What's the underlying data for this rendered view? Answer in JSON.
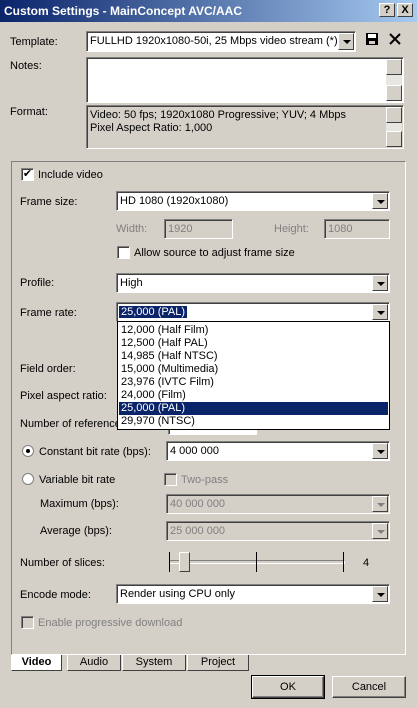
{
  "window": {
    "title": "Custom Settings - MainConcept AVC/AAC",
    "help_btn": "?",
    "close_btn": "X"
  },
  "template": {
    "label": "Template:",
    "value": "FULLHD 1920x1080-50i, 25 Mbps video stream (*)"
  },
  "notes": {
    "label": "Notes:",
    "value": ""
  },
  "format": {
    "label": "Format:",
    "line1": "Video: 50 fps; 1920x1080 Progressive; YUV; 4 Mbps",
    "line2": "Pixel Aspect Ratio: 1,000"
  },
  "video": {
    "include_video": "Include video",
    "frame_size": {
      "label": "Frame size:",
      "value": "HD 1080 (1920x1080)"
    },
    "width": {
      "label": "Width:",
      "value": "1920"
    },
    "height": {
      "label": "Height:",
      "value": "1080"
    },
    "allow_source": "Allow source to adjust frame size",
    "profile": {
      "label": "Profile:",
      "value": "High"
    },
    "frame_rate": {
      "label": "Frame rate:",
      "value": "25,000 (PAL)",
      "options": [
        "12,000 (Half Film)",
        "12,500 (Half PAL)",
        "14,985 (Half NTSC)",
        "15,000 (Multimedia)",
        "23,976 (IVTC Film)",
        "24,000 (Film)",
        "25,000 (PAL)",
        "29,970 (NTSC)"
      ],
      "selected_index": 6
    },
    "field_order": {
      "label": "Field order:"
    },
    "pixel_aspect": {
      "label": "Pixel aspect ratio:"
    },
    "num_reference": {
      "label": "Number of reference"
    },
    "constant_bit_rate": {
      "label": "Constant bit rate (bps):",
      "value": "4 000 000"
    },
    "variable_bit_rate": {
      "label": "Variable bit rate"
    },
    "two_pass": "Two-pass",
    "maximum": {
      "label": "Maximum (bps):",
      "value": "40 000 000"
    },
    "average": {
      "label": "Average (bps):",
      "value": "25 000 000"
    },
    "slices": {
      "label": "Number of slices:",
      "value": "4"
    },
    "encode_mode": {
      "label": "Encode mode:",
      "value": "Render using CPU only"
    },
    "progressive_download": "Enable progressive download"
  },
  "tabs": [
    "Video",
    "Audio",
    "System",
    "Project"
  ],
  "buttons": {
    "ok": "OK",
    "cancel": "Cancel"
  },
  "icons": {
    "save": "save-icon",
    "delete": "delete-icon"
  },
  "colors": {
    "title_start": "#0a246a",
    "title_end": "#a6caf0",
    "selection": "#0a246a",
    "face": "#d4d0c8"
  }
}
